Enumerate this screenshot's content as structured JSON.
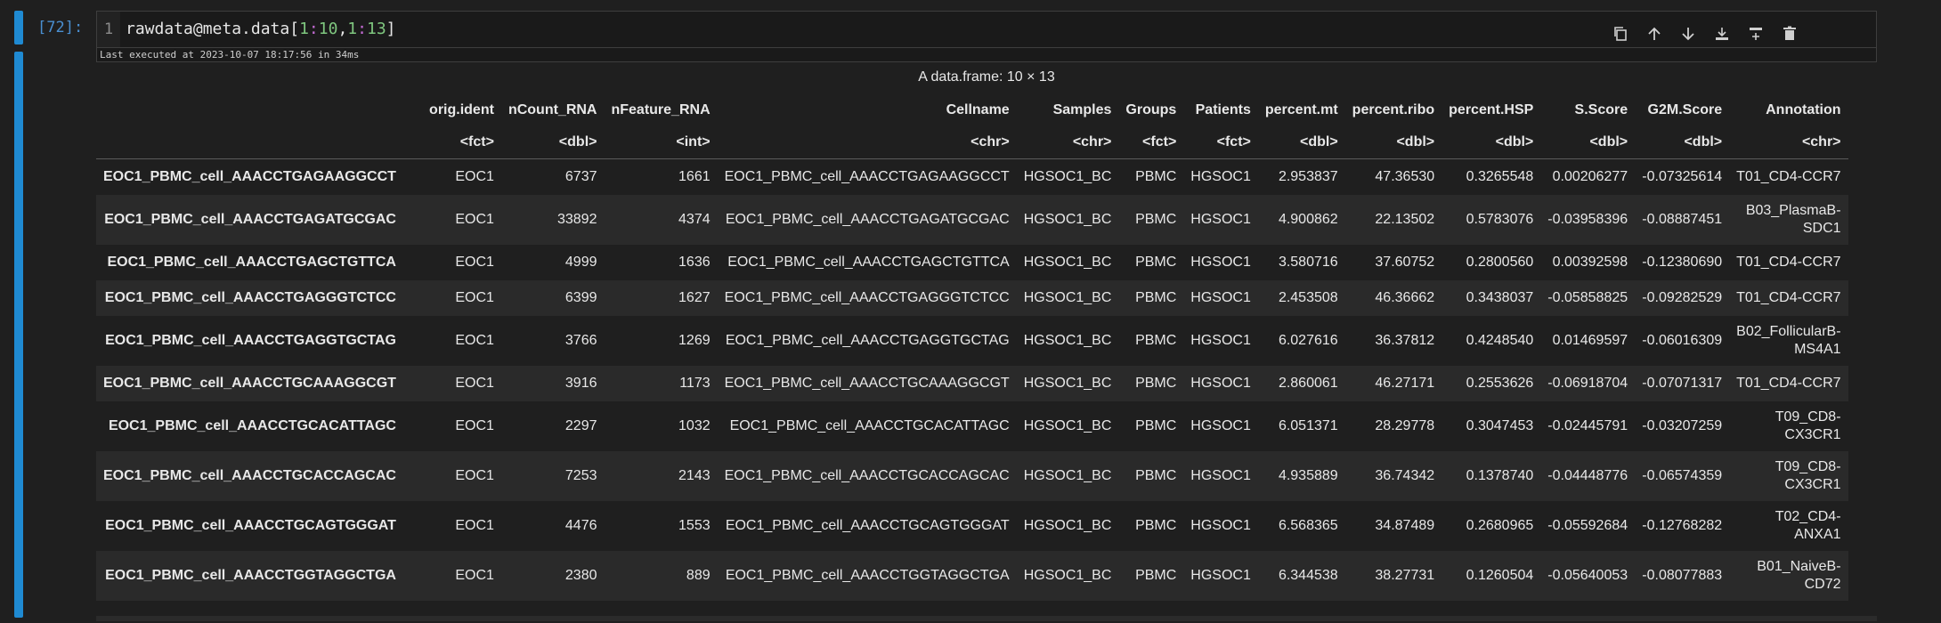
{
  "cell": {
    "prompt": "[72]:",
    "line_number": "1",
    "code": {
      "prefix": "rawdata@meta.data[",
      "a1": "1",
      "c1": ":",
      "a2": "10",
      "comma": ",",
      "b1": "1",
      "c2": ":",
      "b2": "13",
      "suffix": "]"
    },
    "status": "Last executed at 2023-10-07 18:17:56 in 34ms"
  },
  "toolbar_icons": [
    "copy-icon",
    "move-up-icon",
    "move-down-icon",
    "insert-below-icon",
    "insert-above-icon",
    "delete-icon"
  ],
  "output": {
    "caption": "A data.frame: 10 × 13",
    "columns": [
      "",
      "orig.ident",
      "nCount_RNA",
      "nFeature_RNA",
      "Cellname",
      "Samples",
      "Groups",
      "Patients",
      "percent.mt",
      "percent.ribo",
      "percent.HSP",
      "S.Score",
      "G2M.Score",
      "Annotation"
    ],
    "types": [
      "",
      "<fct>",
      "<dbl>",
      "<int>",
      "<chr>",
      "<chr>",
      "<fct>",
      "<fct>",
      "<dbl>",
      "<dbl>",
      "<dbl>",
      "<dbl>",
      "<dbl>",
      "<chr>"
    ],
    "rows": [
      [
        "EOC1_PBMC_cell_AAACCTGAGAAGGCCT",
        "EOC1",
        "6737",
        "1661",
        "EOC1_PBMC_cell_AAACCTGAGAAGGCCT",
        "HGSOC1_BC",
        "PBMC",
        "HGSOC1",
        "2.953837",
        "47.36530",
        "0.3265548",
        "0.00206277",
        "-0.07325614",
        "T01_CD4-CCR7"
      ],
      [
        "EOC1_PBMC_cell_AAACCTGAGATGCGAC",
        "EOC1",
        "33892",
        "4374",
        "EOC1_PBMC_cell_AAACCTGAGATGCGAC",
        "HGSOC1_BC",
        "PBMC",
        "HGSOC1",
        "4.900862",
        "22.13502",
        "0.5783076",
        "-0.03958396",
        "-0.08887451",
        "B03_PlasmaB-SDC1"
      ],
      [
        "EOC1_PBMC_cell_AAACCTGAGCTGTTCA",
        "EOC1",
        "4999",
        "1636",
        "EOC1_PBMC_cell_AAACCTGAGCTGTTCA",
        "HGSOC1_BC",
        "PBMC",
        "HGSOC1",
        "3.580716",
        "37.60752",
        "0.2800560",
        "0.00392598",
        "-0.12380690",
        "T01_CD4-CCR7"
      ],
      [
        "EOC1_PBMC_cell_AAACCTGAGGGTCTCC",
        "EOC1",
        "6399",
        "1627",
        "EOC1_PBMC_cell_AAACCTGAGGGTCTCC",
        "HGSOC1_BC",
        "PBMC",
        "HGSOC1",
        "2.453508",
        "46.36662",
        "0.3438037",
        "-0.05858825",
        "-0.09282529",
        "T01_CD4-CCR7"
      ],
      [
        "EOC1_PBMC_cell_AAACCTGAGGTGCTAG",
        "EOC1",
        "3766",
        "1269",
        "EOC1_PBMC_cell_AAACCTGAGGTGCTAG",
        "HGSOC1_BC",
        "PBMC",
        "HGSOC1",
        "6.027616",
        "36.37812",
        "0.4248540",
        "0.01469597",
        "-0.06016309",
        "B02_FollicularB-MS4A1"
      ],
      [
        "EOC1_PBMC_cell_AAACCTGCAAAGGCGT",
        "EOC1",
        "3916",
        "1173",
        "EOC1_PBMC_cell_AAACCTGCAAAGGCGT",
        "HGSOC1_BC",
        "PBMC",
        "HGSOC1",
        "2.860061",
        "46.27171",
        "0.2553626",
        "-0.06918704",
        "-0.07071317",
        "T01_CD4-CCR7"
      ],
      [
        "EOC1_PBMC_cell_AAACCTGCACATTAGC",
        "EOC1",
        "2297",
        "1032",
        "EOC1_PBMC_cell_AAACCTGCACATTAGC",
        "HGSOC1_BC",
        "PBMC",
        "HGSOC1",
        "6.051371",
        "28.29778",
        "0.3047453",
        "-0.02445791",
        "-0.03207259",
        "T09_CD8-CX3CR1"
      ],
      [
        "EOC1_PBMC_cell_AAACCTGCACCAGCAC",
        "EOC1",
        "7253",
        "2143",
        "EOC1_PBMC_cell_AAACCTGCACCAGCAC",
        "HGSOC1_BC",
        "PBMC",
        "HGSOC1",
        "4.935889",
        "36.74342",
        "0.1378740",
        "-0.04448776",
        "-0.06574359",
        "T09_CD8-CX3CR1"
      ],
      [
        "EOC1_PBMC_cell_AAACCTGCAGTGGGAT",
        "EOC1",
        "4476",
        "1553",
        "EOC1_PBMC_cell_AAACCTGCAGTGGGAT",
        "HGSOC1_BC",
        "PBMC",
        "HGSOC1",
        "6.568365",
        "34.87489",
        "0.2680965",
        "-0.05592684",
        "-0.12768282",
        "T02_CD4-ANXA1"
      ],
      [
        "EOC1_PBMC_cell_AAACCTGGTAGGCTGA",
        "EOC1",
        "2380",
        "889",
        "EOC1_PBMC_cell_AAACCTGGTAGGCTGA",
        "HGSOC1_BC",
        "PBMC",
        "HGSOC1",
        "6.344538",
        "38.27731",
        "0.1260504",
        "-0.05640053",
        "-0.08077883",
        "B01_NaiveB-CD72"
      ]
    ],
    "wrapped_annotations": {
      "1": [
        "B03_PlasmaB-",
        "SDC1"
      ],
      "4": [
        "B02_FollicularB-",
        "MS4A1"
      ],
      "6": [
        "T09_CD8-",
        "CX3CR1"
      ],
      "7": [
        "T09_CD8-",
        "CX3CR1"
      ],
      "8": [
        "T02_CD4-",
        "ANXA1"
      ],
      "9": [
        "B01_NaiveB-",
        "CD72"
      ]
    }
  },
  "colors": {
    "accent": "#1f8ad2",
    "background": "#1f1f1f",
    "row_stripe": "#2a2a2a"
  }
}
